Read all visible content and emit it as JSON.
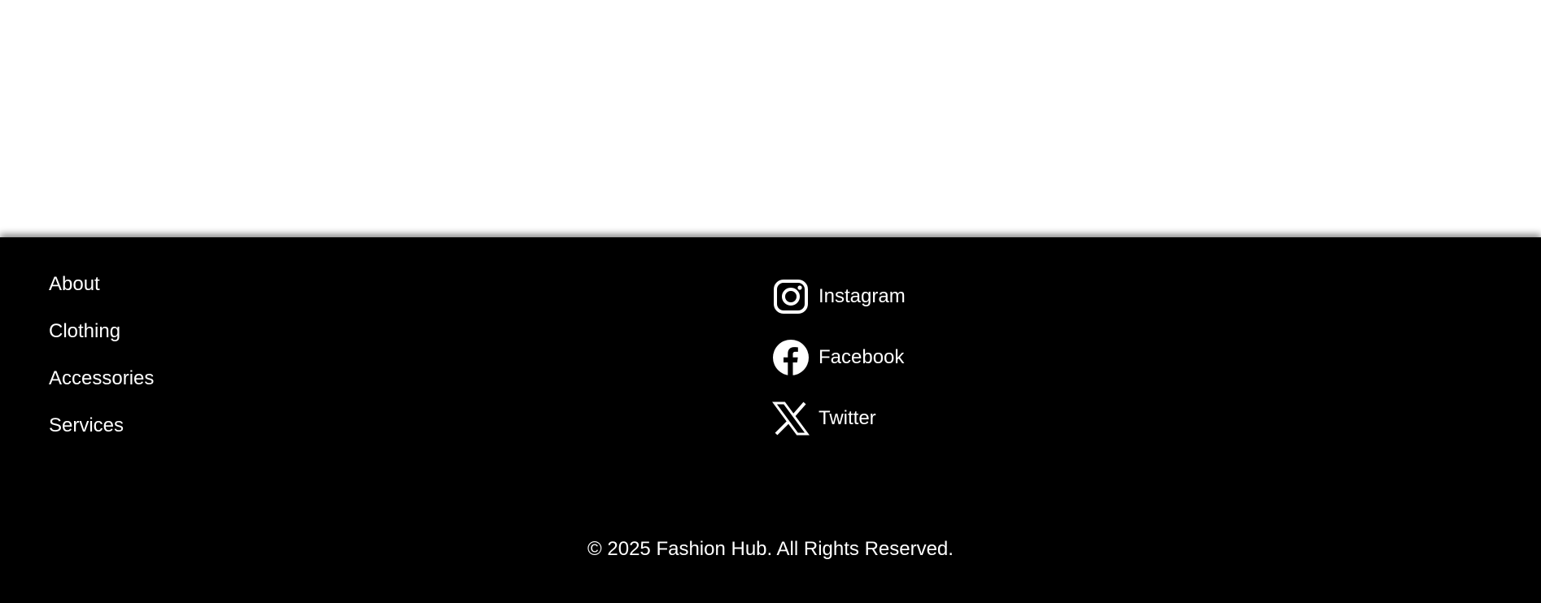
{
  "footer": {
    "nav_links": [
      {
        "label": "About"
      },
      {
        "label": "Clothing"
      },
      {
        "label": "Accessories"
      },
      {
        "label": "Services"
      }
    ],
    "social_links": [
      {
        "label": "Instagram",
        "icon": "instagram-icon"
      },
      {
        "label": "Facebook",
        "icon": "facebook-icon"
      },
      {
        "label": "Twitter",
        "icon": "x-twitter-icon"
      }
    ],
    "copyright": "© 2025 Fashion Hub. All Rights Reserved."
  },
  "colors": {
    "footer_background": "#000000",
    "footer_text": "#ffffff",
    "page_background": "#ffffff"
  }
}
